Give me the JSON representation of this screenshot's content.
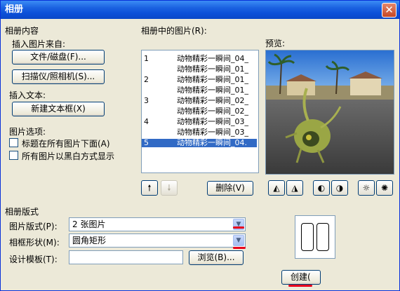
{
  "window": {
    "title": "相册",
    "close_icon": "close-icon"
  },
  "album_content": {
    "section_label": "相册内容",
    "insert_picture_from": "插入图片来自:",
    "file_disk_button": "文件/磁盘(F)...",
    "scanner_camera_button": "扫描仪/照相机(S)...",
    "insert_text": "插入文本:",
    "new_textbox_button": "新建文本框(X)",
    "picture_options": "图片选项:",
    "caption_below_label": "标题在所有图片下面(A)",
    "caption_below_checked": false,
    "all_black_white_label": "所有图片以黑白方式显示",
    "all_black_white_checked": false
  },
  "pictures_list": {
    "label": "相册中的图片(R):",
    "rows": [
      {
        "num": "1",
        "name": "动物精彩一瞬间_04_",
        "selected": false
      },
      {
        "num": "",
        "name": "动物精彩一瞬间_01_",
        "selected": false
      },
      {
        "num": "2",
        "name": "动物精彩一瞬间_01_",
        "selected": false
      },
      {
        "num": "",
        "name": "动物精彩一瞬间_01_",
        "selected": false
      },
      {
        "num": "3",
        "name": "动物精彩一瞬间_02_",
        "selected": false
      },
      {
        "num": "",
        "name": "动物精彩一瞬间_02_",
        "selected": false
      },
      {
        "num": "4",
        "name": "动物精彩一瞬间_03_",
        "selected": false
      },
      {
        "num": "",
        "name": "动物精彩一瞬间_03_",
        "selected": false
      },
      {
        "num": "5",
        "name": "动物精彩一瞬间_04.",
        "selected": true
      }
    ],
    "move_up_icon": "arrow-up-icon",
    "move_down_icon": "arrow-down-icon",
    "delete_button": "删除(V)"
  },
  "preview": {
    "label": "预览:",
    "tool_icons": [
      "rotate-left-icon",
      "rotate-right-icon",
      "contrast-increase-icon",
      "contrast-decrease-icon",
      "brightness-increase-icon",
      "brightness-decrease-icon"
    ]
  },
  "album_layout": {
    "section_label": "相册版式",
    "picture_layout_label": "图片版式(P):",
    "picture_layout_value": "2 张图片",
    "frame_shape_label": "相框形状(M):",
    "frame_shape_value": "圆角矩形",
    "design_template_label": "设计模板(T):",
    "design_template_value": "",
    "browse_button": "浏览(B)..."
  },
  "footer": {
    "create_button": "创建("
  },
  "colors": {
    "annotation_red": "#e8001c",
    "selection_blue": "#316ac5"
  }
}
